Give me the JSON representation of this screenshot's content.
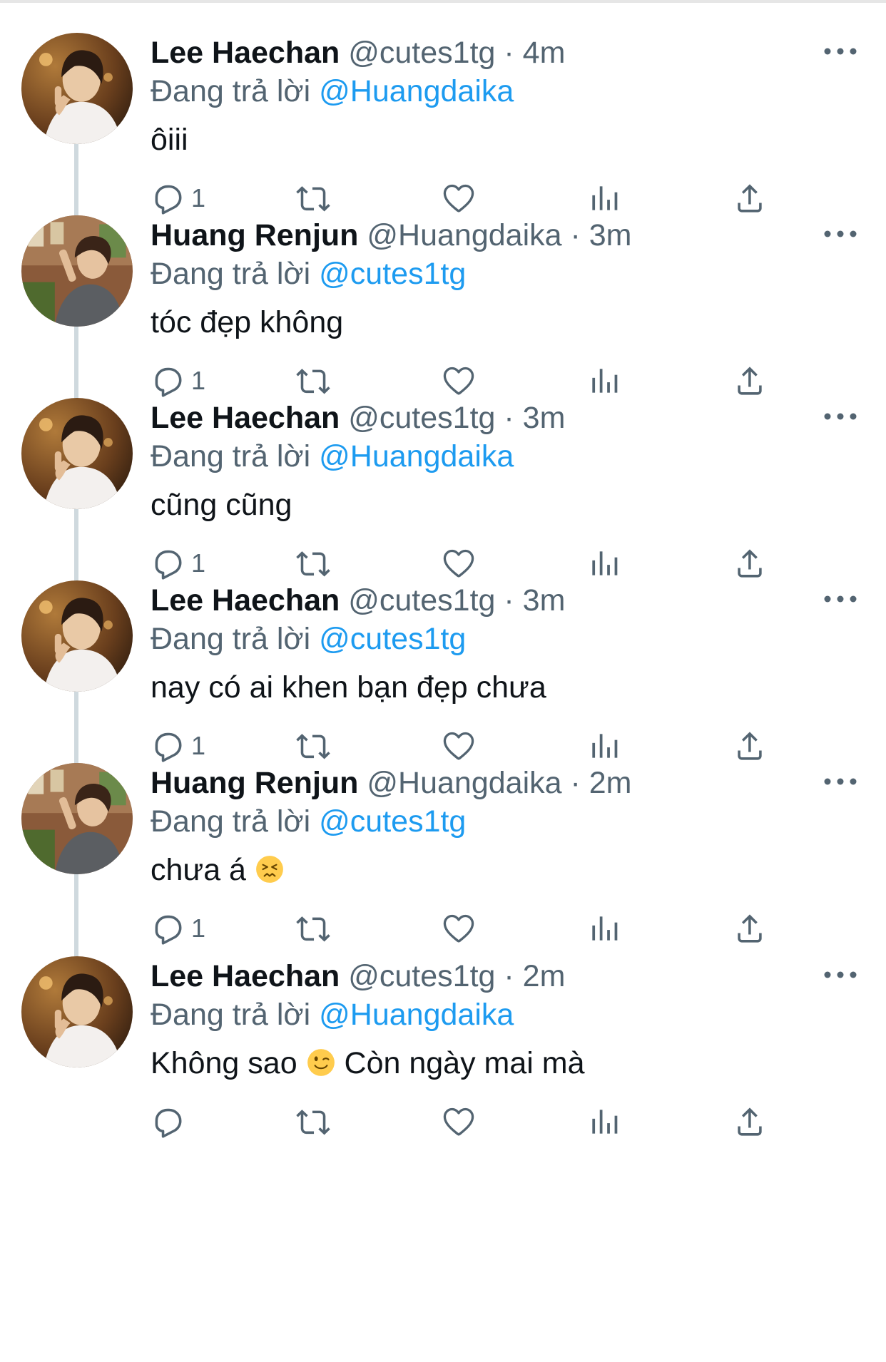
{
  "reply_prefix": "Đang trả lời",
  "tweets": [
    {
      "author": "lee",
      "name": "Lee Haechan",
      "handle_time": "@cutes1tg · 4m",
      "reply_to": "@Huangdaika",
      "text": "ôiii",
      "emoji": "",
      "text_after": "",
      "reply_count": "1"
    },
    {
      "author": "huang",
      "name": "Huang Renjun",
      "handle_time": "@Huangdaika · 3m",
      "reply_to": "@cutes1tg",
      "text": "tóc đẹp không",
      "emoji": "",
      "text_after": "",
      "reply_count": "1"
    },
    {
      "author": "lee",
      "name": "Lee Haechan",
      "handle_time": "@cutes1tg · 3m",
      "reply_to": "@Huangdaika",
      "text": "cũng cũng",
      "emoji": "",
      "text_after": "",
      "reply_count": "1"
    },
    {
      "author": "lee",
      "name": "Lee Haechan",
      "handle_time": "@cutes1tg · 3m",
      "reply_to": "@cutes1tg",
      "text": "nay có ai khen bạn đẹp chưa",
      "emoji": "",
      "text_after": "",
      "reply_count": "1"
    },
    {
      "author": "huang",
      "name": "Huang Renjun",
      "handle_time": "@Huangdaika · 2m",
      "reply_to": "@cutes1tg",
      "text": "chưa á ",
      "emoji": "confounded-face",
      "text_after": "",
      "reply_count": "1"
    },
    {
      "author": "lee",
      "name": "Lee Haechan",
      "handle_time": "@cutes1tg · 2m",
      "reply_to": "@Huangdaika",
      "text": "Không sao ",
      "emoji": "winking-face",
      "text_after": " Còn ngày mai mà",
      "reply_count": ""
    }
  ],
  "icons": {
    "reply": "reply-icon",
    "retweet": "retweet-icon",
    "like": "heart-icon",
    "views": "views-icon",
    "share": "share-icon",
    "more": "more-icon"
  },
  "colors": {
    "mention": "#1d9bf0",
    "secondary": "#536471",
    "thread": "#cfd9de"
  }
}
